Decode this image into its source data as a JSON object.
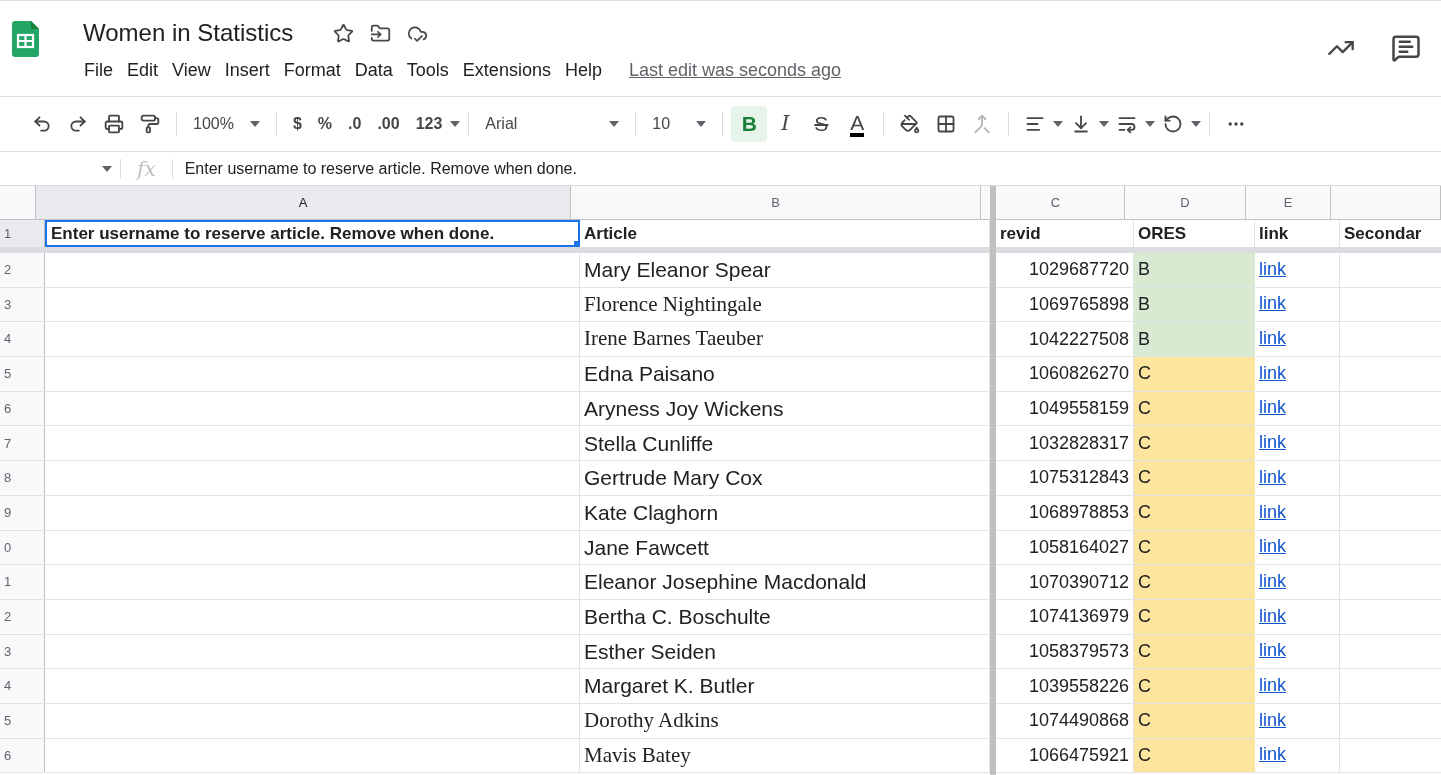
{
  "document": {
    "title": "Women in Statistics",
    "last_edit": "Last edit was seconds ago"
  },
  "menu": [
    "File",
    "Edit",
    "View",
    "Insert",
    "Format",
    "Data",
    "Tools",
    "Extensions",
    "Help"
  ],
  "toolbar": {
    "zoom": "100%",
    "number_formats": [
      "$",
      "%",
      ".0",
      ".00",
      "123"
    ],
    "font": "Arial",
    "font_size": "10",
    "text_styles": [
      {
        "label": "B",
        "kind": "bold",
        "selected": true
      },
      {
        "label": "I",
        "kind": "italic",
        "selected": false
      },
      {
        "label": "S",
        "kind": "strike",
        "selected": false
      },
      {
        "label": "A",
        "kind": "color",
        "selected": false
      }
    ]
  },
  "formula_bar": {
    "label": "fx",
    "value": "Enter username to reserve article. Remove when done."
  },
  "sheet": {
    "columns": [
      {
        "letter": "A",
        "selected": true
      },
      {
        "letter": "B",
        "selected": false
      },
      {
        "letter": "C",
        "selected": false
      },
      {
        "letter": "D",
        "selected": false
      },
      {
        "letter": "E",
        "selected": false
      },
      {
        "selected": false
      }
    ],
    "header_row": {
      "number": "1",
      "cells": [
        "Enter username to reserve article. Remove when done.",
        "Article",
        "revid",
        "ORES",
        "link",
        "Secondar"
      ]
    },
    "rows": [
      {
        "number": "2",
        "article": "Mary Eleanor Spear",
        "kind": "sans",
        "revid": "1029687720",
        "ores": "B",
        "color": "#d9ead3",
        "link": "link"
      },
      {
        "number": "3",
        "article": "Florence Nightingale",
        "kind": "serif",
        "revid": "1069765898",
        "ores": "B",
        "color": "#d9ead3",
        "link": "link"
      },
      {
        "number": "4",
        "article": "Irene Barnes Taeuber",
        "kind": "serif",
        "revid": "1042227508",
        "ores": "B",
        "color": "#d9ead3",
        "link": "link"
      },
      {
        "number": "5",
        "article": "Edna Paisano",
        "kind": "sans",
        "revid": "1060826270",
        "ores": "C",
        "color": "#fde5a0",
        "link": "link"
      },
      {
        "number": "6",
        "article": "Aryness Joy Wickens",
        "kind": "sans",
        "revid": "1049558159",
        "ores": "C",
        "color": "#fde5a0",
        "link": "link"
      },
      {
        "number": "7",
        "article": "Stella Cunliffe",
        "kind": "sans",
        "revid": "1032828317",
        "ores": "C",
        "color": "#fde5a0",
        "link": "link"
      },
      {
        "number": "8",
        "article": "Gertrude Mary Cox",
        "kind": "sans",
        "revid": "1075312843",
        "ores": "C",
        "color": "#fde5a0",
        "link": "link"
      },
      {
        "number": "9",
        "article": "Kate Claghorn",
        "kind": "sans",
        "revid": "1068978853",
        "ores": "C",
        "color": "#fde5a0",
        "link": "link"
      },
      {
        "number": "0",
        "article": "Jane Fawcett",
        "kind": "sans",
        "revid": "1058164027",
        "ores": "C",
        "color": "#fde5a0",
        "link": "link"
      },
      {
        "number": "1",
        "article": "Eleanor Josephine Macdonald",
        "kind": "sans",
        "revid": "1070390712",
        "ores": "C",
        "color": "#fde5a0",
        "link": "link"
      },
      {
        "number": "2",
        "article": "Bertha C. Boschulte",
        "kind": "sans",
        "revid": "1074136979",
        "ores": "C",
        "color": "#fde5a0",
        "link": "link"
      },
      {
        "number": "3",
        "article": "Esther Seiden",
        "kind": "sans",
        "revid": "1058379573",
        "ores": "C",
        "color": "#fde5a0",
        "link": "link"
      },
      {
        "number": "4",
        "article": "Margaret K. Butler",
        "kind": "sans",
        "revid": "1039558226",
        "ores": "C",
        "color": "#fde5a0",
        "link": "link"
      },
      {
        "number": "5",
        "article": "Dorothy Adkins",
        "kind": "serif",
        "revid": "1074490868",
        "ores": "C",
        "color": "#fde5a0",
        "link": "link"
      },
      {
        "number": "6",
        "article": "Mavis Batey",
        "kind": "serif",
        "revid": "1066475921",
        "ores": "C",
        "color": "#fde5a0",
        "link": "link"
      }
    ]
  }
}
